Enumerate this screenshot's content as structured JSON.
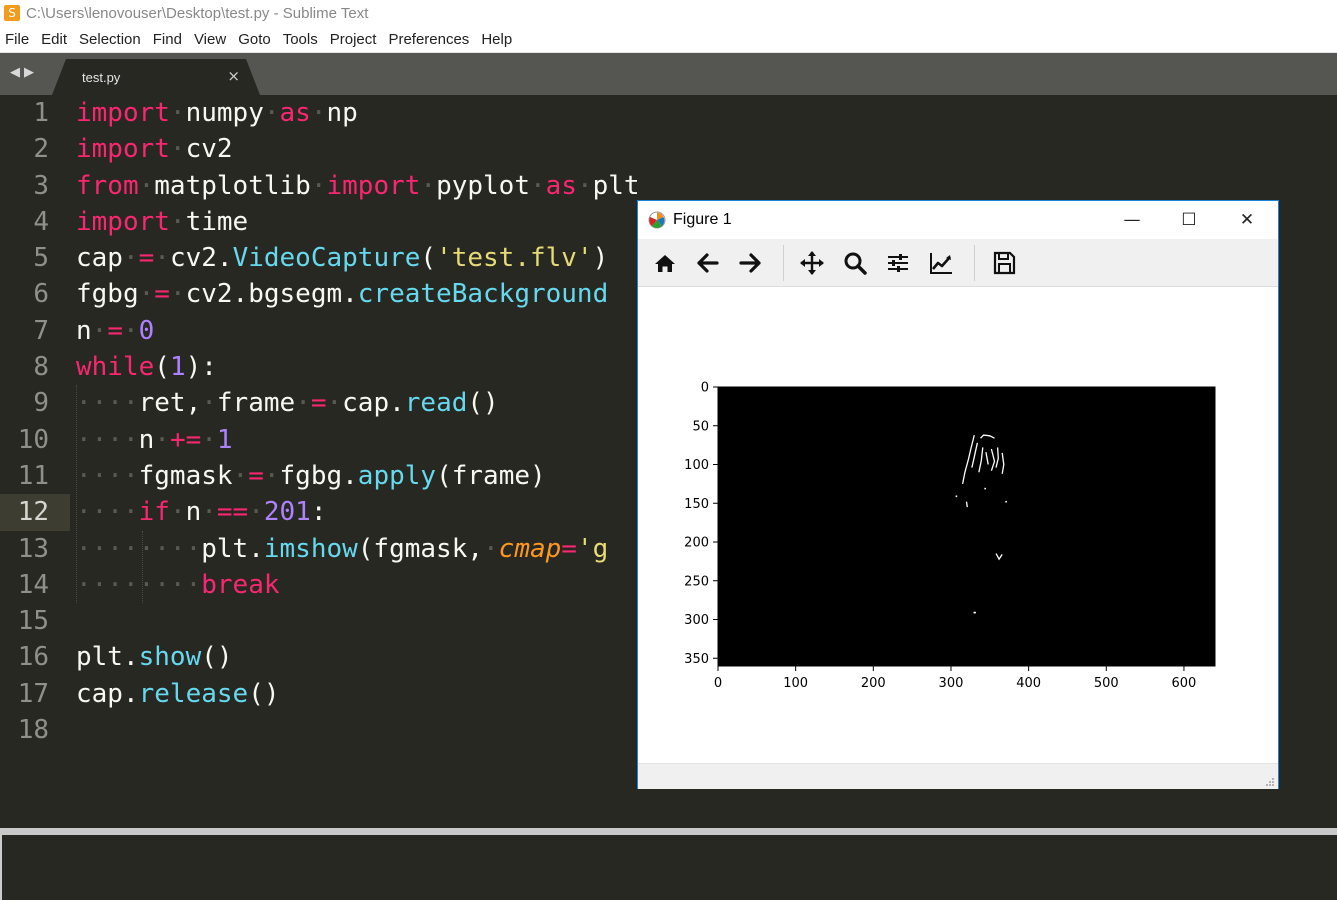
{
  "window": {
    "title": "C:\\Users\\lenovouser\\Desktop\\test.py - Sublime Text"
  },
  "menu": [
    "File",
    "Edit",
    "Selection",
    "Find",
    "View",
    "Goto",
    "Tools",
    "Project",
    "Preferences",
    "Help"
  ],
  "tab": {
    "label": "test.py",
    "close": "×"
  },
  "editor": {
    "active_line": 12,
    "line_numbers": [
      "1",
      "2",
      "3",
      "4",
      "5",
      "6",
      "7",
      "8",
      "9",
      "10",
      "11",
      "12",
      "13",
      "14",
      "15",
      "16",
      "17",
      "18"
    ],
    "lines": [
      [
        [
          "kw",
          "import"
        ],
        [
          "ws",
          "·"
        ],
        [
          "",
          "numpy"
        ],
        [
          "ws",
          "·"
        ],
        [
          "kw",
          "as"
        ],
        [
          "ws",
          "·"
        ],
        [
          "",
          "np"
        ]
      ],
      [
        [
          "kw",
          "import"
        ],
        [
          "ws",
          "·"
        ],
        [
          "",
          "cv2"
        ]
      ],
      [
        [
          "kw",
          "from"
        ],
        [
          "ws",
          "·"
        ],
        [
          "",
          "matplotlib"
        ],
        [
          "ws",
          "·"
        ],
        [
          "kw",
          "import"
        ],
        [
          "ws",
          "·"
        ],
        [
          "",
          "pyplot"
        ],
        [
          "ws",
          "·"
        ],
        [
          "kw",
          "as"
        ],
        [
          "ws",
          "·"
        ],
        [
          "",
          "plt"
        ]
      ],
      [
        [
          "kw",
          "import"
        ],
        [
          "ws",
          "·"
        ],
        [
          "",
          "time"
        ]
      ],
      [
        [
          "",
          "cap"
        ],
        [
          "ws",
          "·"
        ],
        [
          "op",
          "="
        ],
        [
          "ws",
          "·"
        ],
        [
          "",
          "cv2."
        ],
        [
          "fn",
          "VideoCapture"
        ],
        [
          "",
          "("
        ],
        [
          "st",
          "'test.flv'"
        ],
        [
          "",
          ")"
        ]
      ],
      [
        [
          "",
          "fgbg"
        ],
        [
          "ws",
          "·"
        ],
        [
          "op",
          "="
        ],
        [
          "ws",
          "·"
        ],
        [
          "",
          "cv2.bgsegm."
        ],
        [
          "fn",
          "createBackground"
        ]
      ],
      [
        [
          "",
          "n"
        ],
        [
          "ws",
          "·"
        ],
        [
          "op",
          "="
        ],
        [
          "ws",
          "·"
        ],
        [
          "nm",
          "0"
        ]
      ],
      [
        [
          "kw",
          "while"
        ],
        [
          "",
          "("
        ],
        [
          "nm",
          "1"
        ],
        [
          "",
          "):"
        ]
      ],
      [
        [
          "ws",
          "····"
        ],
        [
          "",
          "ret,"
        ],
        [
          "ws",
          "·"
        ],
        [
          "",
          "frame"
        ],
        [
          "ws",
          "·"
        ],
        [
          "op",
          "="
        ],
        [
          "ws",
          "·"
        ],
        [
          "",
          "cap."
        ],
        [
          "fn",
          "read"
        ],
        [
          "",
          "()"
        ]
      ],
      [
        [
          "ws",
          "····"
        ],
        [
          "",
          "n"
        ],
        [
          "ws",
          "·"
        ],
        [
          "op",
          "+="
        ],
        [
          "ws",
          "·"
        ],
        [
          "nm",
          "1"
        ]
      ],
      [
        [
          "ws",
          "····"
        ],
        [
          "",
          "fgmask"
        ],
        [
          "ws",
          "·"
        ],
        [
          "op",
          "="
        ],
        [
          "ws",
          "·"
        ],
        [
          "",
          "fgbg."
        ],
        [
          "fn",
          "apply"
        ],
        [
          "",
          "(frame)"
        ]
      ],
      [
        [
          "ws",
          "····"
        ],
        [
          "kw",
          "if"
        ],
        [
          "ws",
          "·"
        ],
        [
          "",
          "n"
        ],
        [
          "ws",
          "·"
        ],
        [
          "op",
          "=="
        ],
        [
          "ws",
          "·"
        ],
        [
          "nm",
          "201"
        ],
        [
          "",
          ":"
        ]
      ],
      [
        [
          "ws",
          "········"
        ],
        [
          "",
          "plt."
        ],
        [
          "fn",
          "imshow"
        ],
        [
          "",
          "(fgmask,"
        ],
        [
          "ws",
          "·"
        ],
        [
          "ar",
          "cmap"
        ],
        [
          "op",
          "="
        ],
        [
          "st",
          "'g"
        ]
      ],
      [
        [
          "ws",
          "········"
        ],
        [
          "kw",
          "break"
        ]
      ],
      [],
      [
        [
          "",
          "plt."
        ],
        [
          "fn",
          "show"
        ],
        [
          "",
          "()"
        ]
      ],
      [
        [
          "",
          "cap."
        ],
        [
          "fn",
          "release"
        ],
        [
          "",
          "()"
        ]
      ],
      []
    ]
  },
  "figure": {
    "title": "Figure 1",
    "controls": {
      "minimize": "—",
      "maximize": "☐",
      "close": "✕"
    },
    "toolbar": [
      "home-icon",
      "back-icon",
      "forward-icon",
      "pan-icon",
      "zoom-icon",
      "configure-subplots-icon",
      "edit-axis-icon",
      "save-icon"
    ],
    "chart_data": {
      "type": "heatmap",
      "colormap": "gray",
      "x_ticks": [
        "0",
        "100",
        "200",
        "300",
        "400",
        "500",
        "600"
      ],
      "y_ticks": [
        "0",
        "50",
        "100",
        "150",
        "200",
        "250",
        "300",
        "350"
      ],
      "xlim": [
        0,
        640
      ],
      "ylim": [
        360,
        0
      ],
      "background": "#000000",
      "foreground": "#ffffff"
    }
  },
  "colors": {
    "keyword": "#f92672",
    "function": "#66d9ef",
    "string": "#e6db74",
    "number": "#ae81ff",
    "argument": "#fd971f",
    "text": "#f8f8f2",
    "background": "#272822"
  }
}
